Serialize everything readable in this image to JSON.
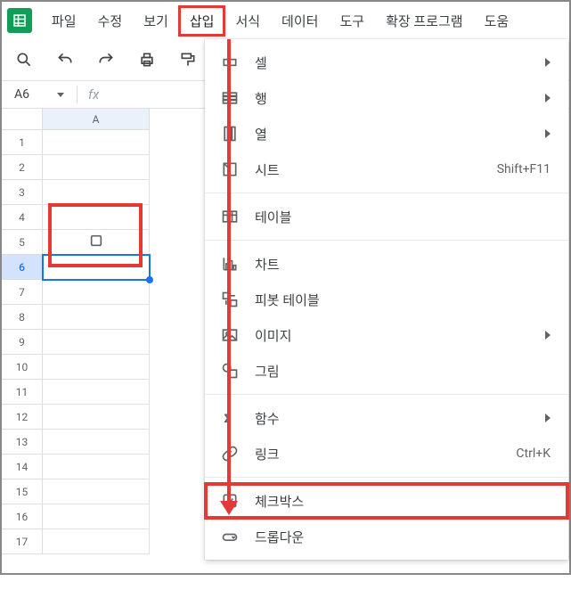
{
  "menubar": {
    "items": [
      {
        "label": "파일"
      },
      {
        "label": "수정"
      },
      {
        "label": "보기"
      },
      {
        "label": "삽입"
      },
      {
        "label": "서식"
      },
      {
        "label": "데이터"
      },
      {
        "label": "도구"
      },
      {
        "label": "확장 프로그램"
      },
      {
        "label": "도움"
      }
    ],
    "active_index": 3
  },
  "namebox": {
    "value": "A6"
  },
  "fx_label": "fx",
  "grid": {
    "col_header": "A",
    "row_count": 17,
    "selected_row": 6,
    "checkbox_row": 5
  },
  "dropdown": {
    "groups": [
      [
        {
          "icon": "cell",
          "label": "셀",
          "submenu": true
        },
        {
          "icon": "rows",
          "label": "행",
          "submenu": true
        },
        {
          "icon": "cols",
          "label": "열",
          "submenu": true
        },
        {
          "icon": "sheet",
          "label": "시트",
          "shortcut": "Shift+F11"
        }
      ],
      [
        {
          "icon": "table",
          "label": "테이블"
        }
      ],
      [
        {
          "icon": "chart",
          "label": "차트"
        },
        {
          "icon": "pivot",
          "label": "피봇 테이블"
        },
        {
          "icon": "image",
          "label": "이미지",
          "submenu": true
        },
        {
          "icon": "drawing",
          "label": "그림"
        }
      ],
      [
        {
          "icon": "function",
          "label": "함수",
          "submenu": true
        },
        {
          "icon": "link",
          "label": "링크",
          "shortcut": "Ctrl+K"
        }
      ],
      [
        {
          "icon": "checkbox",
          "label": "체크박스",
          "highlight": true
        },
        {
          "icon": "dropdown",
          "label": "드롭다운"
        }
      ]
    ]
  }
}
